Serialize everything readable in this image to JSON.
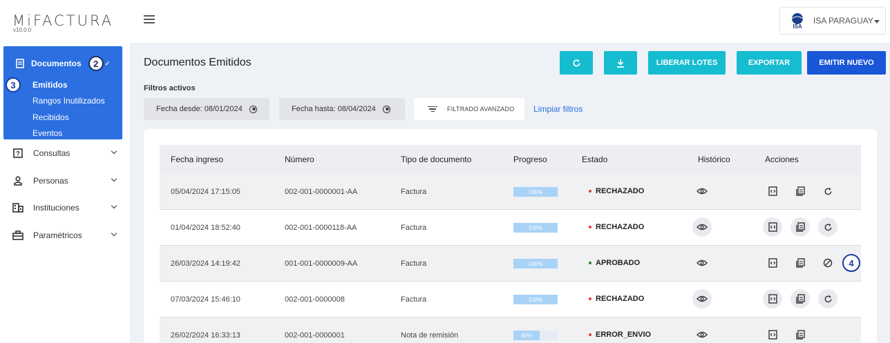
{
  "app": {
    "logo": "MiFACTURA",
    "version": "v10.0.0"
  },
  "company": {
    "name": "ISA PARAGUAY",
    "logo_text": "ISA"
  },
  "sidebar": {
    "active": {
      "label": "Documentos",
      "badge": "2"
    },
    "sub_badge": "3",
    "subitems": [
      "Emitidos",
      "Rangos Inutilizados",
      "Recibidos",
      "Eventos"
    ],
    "items": [
      {
        "label": "Consultas",
        "icon": "question-doc-icon"
      },
      {
        "label": "Personas",
        "icon": "person-icon"
      },
      {
        "label": "Instituciones",
        "icon": "building-icon"
      },
      {
        "label": "Paramétricos",
        "icon": "briefcase-icon"
      }
    ]
  },
  "main": {
    "title": "Documentos Emitidos",
    "buttons": {
      "refresh": "refresh-icon",
      "download": "download-icon",
      "release": "LIBERAR LOTES",
      "export": "EXPORTAR",
      "new": "EMITIR NUEVO"
    },
    "filters_label": "Filtros activos",
    "chips": [
      "Fecha desde: 08/01/2024",
      "Fecha hasta: 08/04/2024"
    ],
    "advanced": "FILTRADO AVANZADO",
    "clear": "Limpiar filtros"
  },
  "table": {
    "headers": [
      "Fecha ingreso",
      "Número",
      "Tipo de documento",
      "Progreso",
      "Estado",
      "Histórico",
      "Acciones"
    ],
    "rows": [
      {
        "fecha": "05/04/2024 17:15:05",
        "numero": "002-001-0000001-AA",
        "tipo": "Factura",
        "progreso": "100%",
        "estado": "RECHAZADO"
      },
      {
        "fecha": "01/04/2024 18:52:40",
        "numero": "002-001-0000118-AA",
        "tipo": "Factura",
        "progreso": "100%",
        "estado": "RECHAZADO"
      },
      {
        "fecha": "26/03/2024 14:19:42",
        "numero": "001-001-0000009-AA",
        "tipo": "Factura",
        "progreso": "100%",
        "estado": "APROBADO",
        "badge": "4"
      },
      {
        "fecha": "07/03/2024 15:46:10",
        "numero": "002-001-0000008",
        "tipo": "Factura",
        "progreso": "100%",
        "estado": "RECHAZADO"
      },
      {
        "fecha": "26/02/2024 16:33:13",
        "numero": "002-001-0000001",
        "tipo": "Nota de remisión",
        "progreso": "60%",
        "estado": "ERROR_ENVIO"
      }
    ]
  },
  "colors": {
    "primary": "#2b6fe0",
    "cyan": "#16bcd0",
    "emit": "#1a56d8",
    "rejected": "#e53935",
    "approved": "#2e7d32",
    "progress": "#a9d2f7"
  }
}
